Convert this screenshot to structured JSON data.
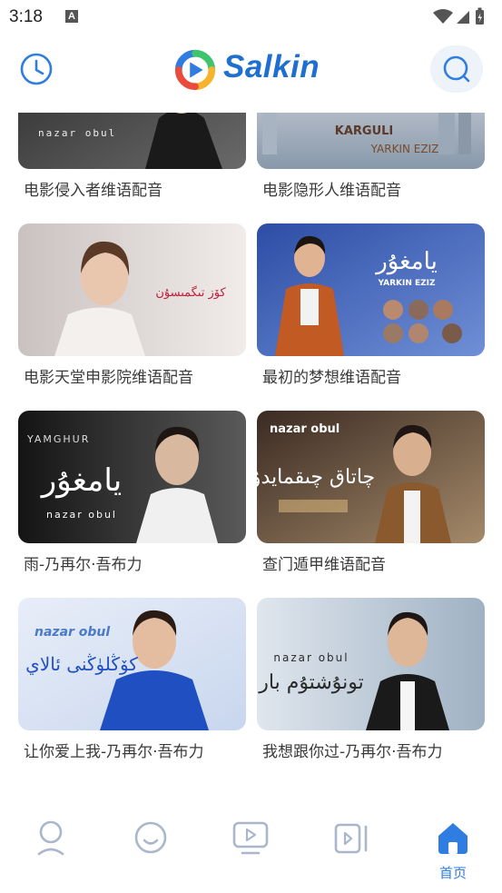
{
  "status": {
    "time": "3:18",
    "notif_letter": "A"
  },
  "header": {
    "app_name": "Salkin",
    "history_icon": "clock-icon",
    "search_icon": "search-icon"
  },
  "videos": [
    {
      "title": "电影侵入者维语配音",
      "thumb_text": "nazar obul",
      "thumb_sub": "",
      "colors": [
        "#2a2a2a",
        "#6a6a6a"
      ]
    },
    {
      "title": "电影隐形人维语配音",
      "thumb_text": "KARGULI",
      "thumb_sub": "YARKIN EZIZ",
      "colors": [
        "#e8e4ea",
        "#8899aa"
      ]
    },
    {
      "title": "电影天堂申影院维语配音",
      "thumb_text": "",
      "thumb_sub": "",
      "colors": [
        "#f1ecea",
        "#c9c2c0"
      ]
    },
    {
      "title": "最初的梦想维语配音",
      "thumb_text": "YARKIN EZIZ",
      "thumb_sub": "",
      "colors": [
        "#2d4da6",
        "#6f8fd6"
      ]
    },
    {
      "title": "雨-乃再尔·吾布力",
      "thumb_text": "YAMGHUR",
      "thumb_sub": "nazar obul",
      "colors": [
        "#141414",
        "#5a5a5a"
      ]
    },
    {
      "title": "查门遁甲维语配音",
      "thumb_text": "nazar obul",
      "thumb_sub": "",
      "colors": [
        "#3a2a22",
        "#a58a6a"
      ]
    },
    {
      "title": "让你爱上我-乃再尔·吾布力",
      "thumb_text": "nazar obul",
      "thumb_sub": "",
      "colors": [
        "#e8eef8",
        "#1f4fc0"
      ]
    },
    {
      "title": "我想跟你过-乃再尔·吾布力",
      "thumb_text": "nazar obul",
      "thumb_sub": "",
      "colors": [
        "#dfe6ee",
        "#7f95ab"
      ]
    }
  ],
  "nav": [
    {
      "icon": "profile-icon",
      "label": ""
    },
    {
      "icon": "smile-icon",
      "label": ""
    },
    {
      "icon": "play-screen-icon",
      "label": ""
    },
    {
      "icon": "video-icon",
      "label": ""
    },
    {
      "icon": "home-icon",
      "label": "首页"
    }
  ],
  "colors": {
    "accent": "#2f7de1",
    "icon_gray": "#a9b6cc"
  }
}
